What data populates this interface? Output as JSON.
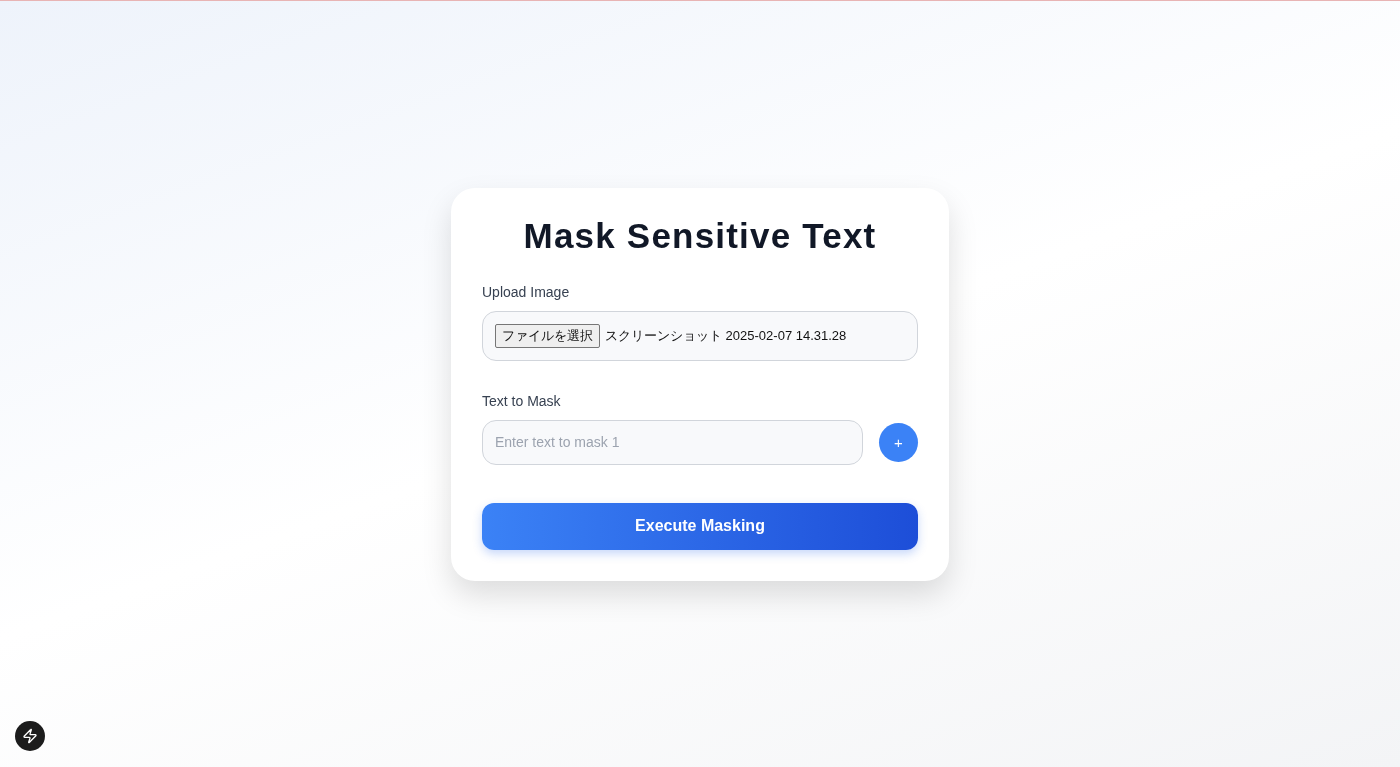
{
  "title": "Mask Sensitive Text",
  "upload": {
    "label": "Upload Image",
    "button": "ファイルを選択",
    "file_name": "スクリーンショット 2025-02-07 14.31.28"
  },
  "mask": {
    "label": "Text to Mask",
    "fields": [
      {
        "placeholder": "Enter text to mask 1"
      }
    ],
    "add_button": "+"
  },
  "submit": "Execute Masking"
}
